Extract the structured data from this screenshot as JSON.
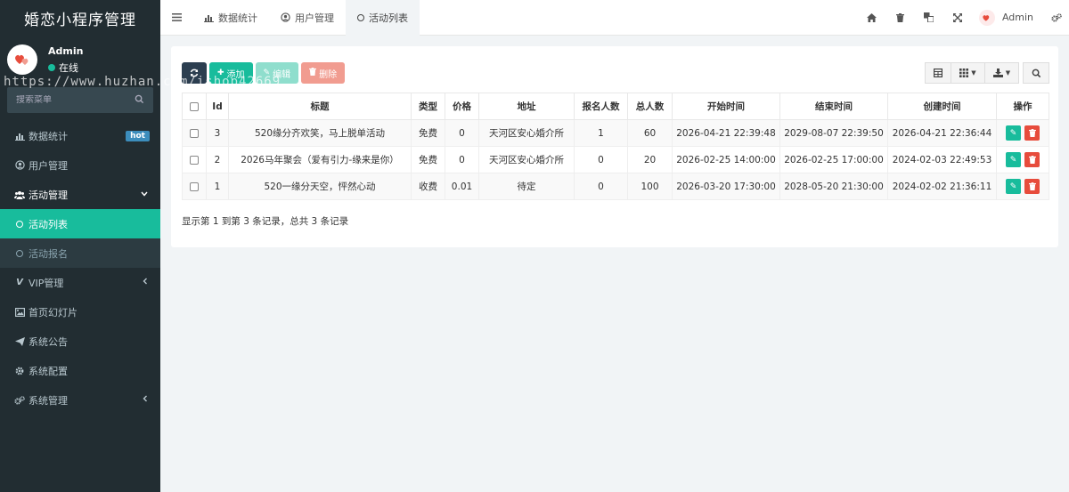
{
  "app": {
    "title": "婚恋小程序管理"
  },
  "user": {
    "name": "Admin",
    "status": "在线"
  },
  "sidebar": {
    "search_placeholder": "搜索菜单",
    "items": [
      {
        "label": "数据统计",
        "icon": "bar-chart-icon",
        "badge": "hot"
      },
      {
        "label": "用户管理",
        "icon": "user-circle-icon"
      },
      {
        "label": "活动管理",
        "icon": "users-icon"
      },
      {
        "label": "VIP管理",
        "icon": "vimeo-icon"
      },
      {
        "label": "首页幻灯片",
        "icon": "image-icon"
      },
      {
        "label": "系统公告",
        "icon": "paper-plane-icon"
      },
      {
        "label": "系统配置",
        "icon": "gear-icon"
      },
      {
        "label": "系统管理",
        "icon": "gears-icon"
      }
    ],
    "sub_items": [
      {
        "label": "活动列表",
        "active": true
      },
      {
        "label": "活动报名",
        "active": false
      }
    ]
  },
  "topbar": {
    "tabs": [
      {
        "label": "数据统计"
      },
      {
        "label": "用户管理"
      },
      {
        "label": "活动列表"
      }
    ],
    "user_label": "Admin"
  },
  "toolbar": {
    "add_label": "添加",
    "edit_label": "编辑",
    "delete_label": "删除"
  },
  "table": {
    "headers": [
      "Id",
      "标题",
      "类型",
      "价格",
      "地址",
      "报名人数",
      "总人数",
      "开始时间",
      "结束时间",
      "创建时间",
      "操作"
    ],
    "rows": [
      {
        "id": "3",
        "title": "520缘分齐欢笑，马上脱单活动",
        "type": "免费",
        "price": "0",
        "address": "天河区安心婚介所",
        "signed": "1",
        "total": "60",
        "start": "2026-04-21 22:39:48",
        "end": "2029-08-07 22:39:50",
        "created": "2026-04-21 22:36:44"
      },
      {
        "id": "2",
        "title": "2026马年聚会（爱有引力-缘来是你）",
        "type": "免费",
        "price": "0",
        "address": "天河区安心婚介所",
        "signed": "0",
        "total": "20",
        "start": "2026-02-25 14:00:00",
        "end": "2026-02-25 17:00:00",
        "created": "2024-02-03 22:49:53"
      },
      {
        "id": "1",
        "title": "520一缘分天空，怦然心动",
        "type": "收费",
        "price": "0.01",
        "address": "待定",
        "signed": "0",
        "total": "100",
        "start": "2026-03-20 17:30:00",
        "end": "2028-05-20 21:30:00",
        "created": "2024-02-02 21:36:11"
      }
    ],
    "footer": "显示第 1 到第 3 条记录，总共 3 条记录"
  },
  "watermark": "https://www.huzhan.com/ishop42669",
  "colors": {
    "sidebar_bg": "#222d32",
    "accent": "#18bc9c",
    "danger": "#e74c3c",
    "dark": "#2c3e50"
  }
}
